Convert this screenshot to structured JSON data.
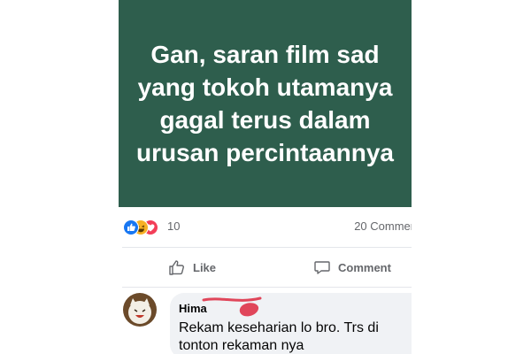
{
  "status_post": {
    "text": "Gan, saran film sad\nyang tokoh utamanya\ngagal terus dalam\nurusan percintaannya",
    "background_color": "#2e5e4d"
  },
  "reactions": {
    "icons": [
      "like-icon",
      "haha-icon",
      "love-icon"
    ],
    "count": "10",
    "comments_label": "20 Commen"
  },
  "actions": {
    "like_label": "Like",
    "comment_label": "Comment"
  },
  "comment": {
    "author": "Hima",
    "text": "Rekam keseharian lo bro. Trs di tonton rekaman nya",
    "redaction_color": "#e0465a"
  }
}
